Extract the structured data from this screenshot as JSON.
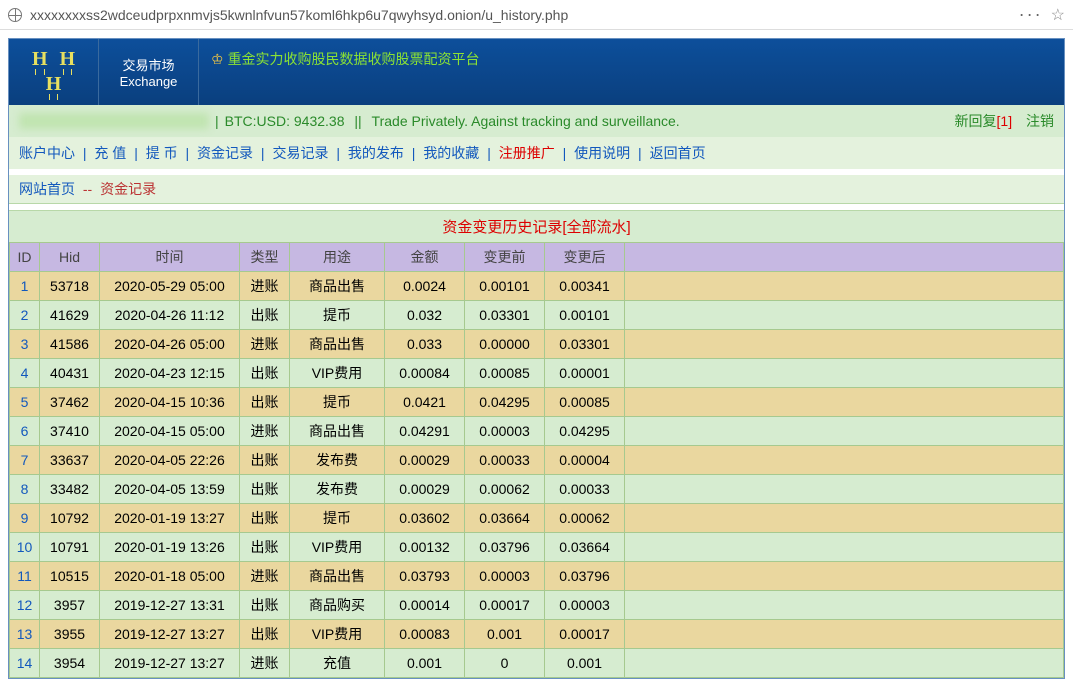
{
  "url": "xxxxxxxxss2wdceudprpxnmvjs5kwnlnfvun57koml6hkp6u7qwyhsyd.onion/u_history.php",
  "exchange": {
    "cn": "交易市场",
    "en": "Exchange"
  },
  "banner": "重金实力收购股民数据收购股票配资平台",
  "strip": {
    "btc": "BTC:USD: 9432.38",
    "tag": "Trade Privately. Against tracking and surveillance.",
    "newreply": "新回复",
    "count": "[1]",
    "logout": "注销"
  },
  "nav": [
    "账户中心",
    "充 值",
    "提 币",
    "资金记录",
    "交易记录",
    "我的发布",
    "我的收藏",
    "注册推广",
    "使用说明",
    "返回首页"
  ],
  "nav_red_index": 7,
  "breadcrumb": {
    "home": "网站首页",
    "dash": "--",
    "cur": "资金记录"
  },
  "table_title": "资金变更历史记录[全部流水]",
  "headers": [
    "ID",
    "Hid",
    "时间",
    "类型",
    "用途",
    "金额",
    "变更前",
    "变更后"
  ],
  "rows": [
    {
      "id": "1",
      "hid": "53718",
      "time": "2020-05-29 05:00",
      "type": "进账",
      "use": "商品出售",
      "amt": "0.0024",
      "bef": "0.00101",
      "aft": "0.00341"
    },
    {
      "id": "2",
      "hid": "41629",
      "time": "2020-04-26 11:12",
      "type": "出账",
      "use": "提币",
      "amt": "0.032",
      "bef": "0.03301",
      "aft": "0.00101"
    },
    {
      "id": "3",
      "hid": "41586",
      "time": "2020-04-26 05:00",
      "type": "进账",
      "use": "商品出售",
      "amt": "0.033",
      "bef": "0.00000",
      "aft": "0.03301"
    },
    {
      "id": "4",
      "hid": "40431",
      "time": "2020-04-23 12:15",
      "type": "出账",
      "use": "VIP费用",
      "amt": "0.00084",
      "bef": "0.00085",
      "aft": "0.00001"
    },
    {
      "id": "5",
      "hid": "37462",
      "time": "2020-04-15 10:36",
      "type": "出账",
      "use": "提币",
      "amt": "0.0421",
      "bef": "0.04295",
      "aft": "0.00085"
    },
    {
      "id": "6",
      "hid": "37410",
      "time": "2020-04-15 05:00",
      "type": "进账",
      "use": "商品出售",
      "amt": "0.04291",
      "bef": "0.00003",
      "aft": "0.04295"
    },
    {
      "id": "7",
      "hid": "33637",
      "time": "2020-04-05 22:26",
      "type": "出账",
      "use": "发布费",
      "amt": "0.00029",
      "bef": "0.00033",
      "aft": "0.00004"
    },
    {
      "id": "8",
      "hid": "33482",
      "time": "2020-04-05 13:59",
      "type": "出账",
      "use": "发布费",
      "amt": "0.00029",
      "bef": "0.00062",
      "aft": "0.00033"
    },
    {
      "id": "9",
      "hid": "10792",
      "time": "2020-01-19 13:27",
      "type": "出账",
      "use": "提币",
      "amt": "0.03602",
      "bef": "0.03664",
      "aft": "0.00062"
    },
    {
      "id": "10",
      "hid": "10791",
      "time": "2020-01-19 13:26",
      "type": "出账",
      "use": "VIP费用",
      "amt": "0.00132",
      "bef": "0.03796",
      "aft": "0.03664"
    },
    {
      "id": "11",
      "hid": "10515",
      "time": "2020-01-18 05:00",
      "type": "进账",
      "use": "商品出售",
      "amt": "0.03793",
      "bef": "0.00003",
      "aft": "0.03796"
    },
    {
      "id": "12",
      "hid": "3957",
      "time": "2019-12-27 13:31",
      "type": "出账",
      "use": "商品购买",
      "amt": "0.00014",
      "bef": "0.00017",
      "aft": "0.00003"
    },
    {
      "id": "13",
      "hid": "3955",
      "time": "2019-12-27 13:27",
      "type": "出账",
      "use": "VIP费用",
      "amt": "0.00083",
      "bef": "0.001",
      "aft": "0.00017"
    },
    {
      "id": "14",
      "hid": "3954",
      "time": "2019-12-27 13:27",
      "type": "进账",
      "use": "充值",
      "amt": "0.001",
      "bef": "0",
      "aft": "0.001"
    }
  ]
}
